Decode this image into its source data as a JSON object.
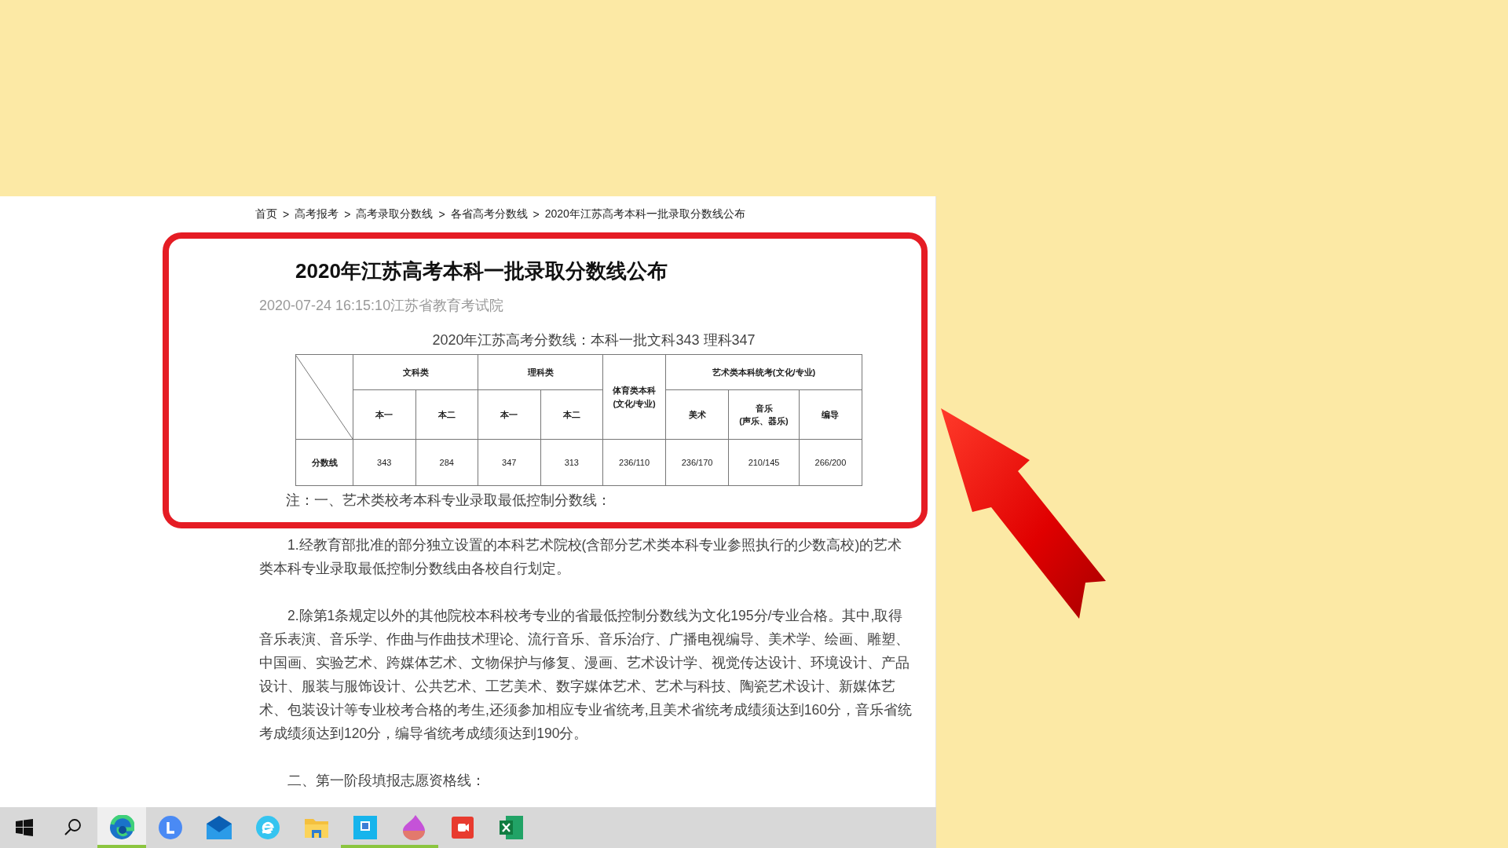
{
  "breadcrumb": {
    "separator": ">",
    "items": [
      "首页",
      "高考报考",
      "高考录取分数线",
      "各省高考分数线",
      "2020年江苏高考本科一批录取分数线公布"
    ]
  },
  "article": {
    "title": "2020年江苏高考本科一批录取分数线公布",
    "meta": "2020-07-24 16:15:10江苏省教育考试院",
    "caption": "2020年江苏高考分数线：本科一批文科343 理科347",
    "table": {
      "groups": [
        {
          "label": "文科类",
          "columns": [
            "本一",
            "本二"
          ]
        },
        {
          "label": "理科类",
          "columns": [
            "本一",
            "本二"
          ]
        },
        {
          "label": "体育类本科\n(文化/专业)"
        },
        {
          "label": "艺术类本科统考(文化/专业)",
          "columns": [
            "美术",
            "音乐\n(声乐、器乐)",
            "编导"
          ]
        }
      ],
      "rows": [
        {
          "label": "分数线",
          "values": [
            "343",
            "284",
            "347",
            "313",
            "236/110",
            "236/170",
            "210/145",
            "266/200"
          ]
        }
      ]
    },
    "note": "注：一、艺术类校考本科专业录取最低控制分数线：",
    "paragraphs": [
      "1.经教育部批准的部分独立设置的本科艺术院校(含部分艺术类本科专业参照执行的少数高校)的艺术类本科专业录取最低控制分数线由各校自行划定。",
      "2.除第1条规定以外的其他院校本科校考专业的省最低控制分数线为文化195分/专业合格。其中,取得音乐表演、音乐学、作曲与作曲技术理论、流行音乐、音乐治疗、广播电视编导、美术学、绘画、雕塑、中国画、实验艺术、跨媒体艺术、文物保护与修复、漫画、艺术设计学、视觉传达设计、环境设计、产品设计、服装与服饰设计、公共艺术、工艺美术、数字媒体艺术、艺术与科技、陶瓷艺术设计、新媒体艺术、包装设计等专业校考合格的考生,还须参加相应专业省统考,且美术省统考成绩须达到160分，音乐省统考成绩须达到120分，编导省统考成绩须达到190分。",
      "二、第一阶段填报志愿资格线："
    ]
  },
  "taskbar": {
    "items": [
      {
        "kind": "start",
        "selected": false,
        "running": false
      },
      {
        "kind": "search",
        "selected": false,
        "running": false
      },
      {
        "kind": "edge",
        "selected": true,
        "running": true
      },
      {
        "kind": "letter",
        "selected": false,
        "running": false
      },
      {
        "kind": "mail",
        "selected": false,
        "running": false
      },
      {
        "kind": "browser",
        "selected": false,
        "running": false
      },
      {
        "kind": "folder",
        "selected": false,
        "running": false
      },
      {
        "kind": "app",
        "selected": false,
        "running": true
      },
      {
        "kind": "paint",
        "selected": false,
        "running": true
      },
      {
        "kind": "recorder",
        "selected": false,
        "running": false
      },
      {
        "kind": "excel",
        "selected": false,
        "running": false
      }
    ]
  }
}
